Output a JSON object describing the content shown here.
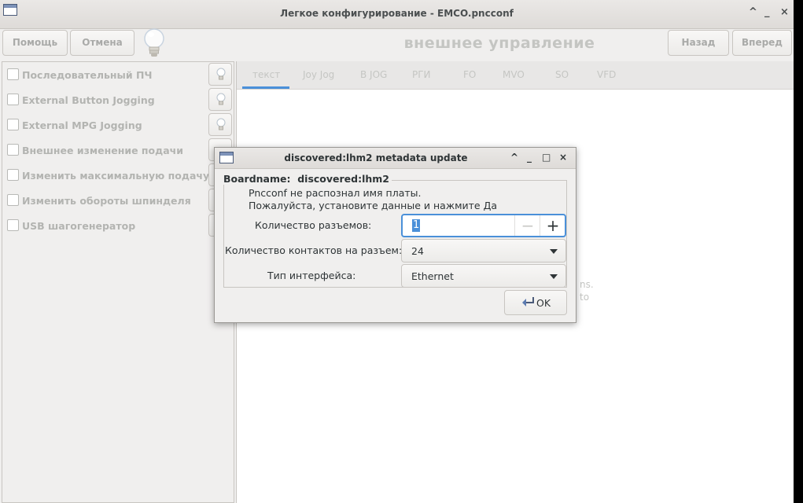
{
  "window": {
    "title": "Легкое конфигурирование - EMCO.pncconf",
    "controls": [
      "^",
      "_",
      "×"
    ]
  },
  "toolbar": {
    "help_label": "Помощь",
    "cancel_label": "Отмена",
    "section_title": "внешнее управление",
    "back_label": "Назад",
    "forward_label": "Вперед"
  },
  "left_options": [
    {
      "label": "Последовательный ПЧ",
      "checked": false
    },
    {
      "label": "External Button Jogging",
      "checked": false
    },
    {
      "label": "External MPG Jogging",
      "checked": false
    },
    {
      "label": "Внешнее изменение подачи",
      "checked": false
    },
    {
      "label": "Изменить максимальную подачу",
      "checked": false
    },
    {
      "label": "Изменить обороты шпинделя",
      "checked": false
    },
    {
      "label": "USB шагогенератор",
      "checked": false
    }
  ],
  "tabs": [
    "текст",
    "Joy Jog",
    "В JOG",
    "РГИ",
    "FO",
    "MVO",
    "SO",
    "VFD"
  ],
  "active_tab": "текст",
  "background_fragments": [
    "ns.",
    "to"
  ],
  "dialog": {
    "title": "discovered:lhm2 metadata update",
    "controls": [
      "^",
      "_",
      "□",
      "×"
    ],
    "board_label": "Boardname:",
    "board_name": "discovered:lhm2",
    "message_line1": "Pncconf не распознал имя платы.",
    "message_line2": "Пожалуйста, установите данные и нажмите Да",
    "connectors_label": "Количество разъемов:",
    "connectors_value": "1",
    "pins_label": "Количество контактов на разъем:",
    "pins_value": "24",
    "interface_label": "Тип интерфейса:",
    "interface_value": "Ethernet",
    "ok_label": "OK"
  },
  "colors": {
    "accent": "#4a90d9",
    "disabled_text": "#b3b4b1",
    "window_bg": "#f0efee"
  }
}
